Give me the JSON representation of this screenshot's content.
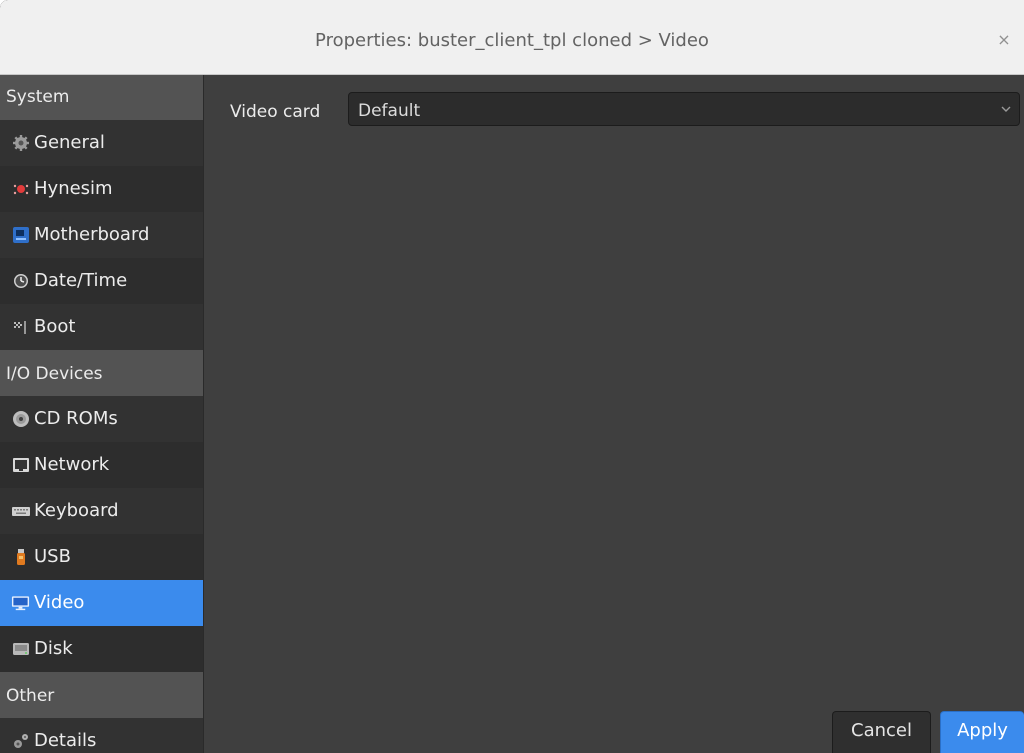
{
  "window": {
    "title": "Properties: buster_client_tpl cloned > Video",
    "close_glyph": "×"
  },
  "sidebar": {
    "sections": [
      {
        "label": "System"
      },
      {
        "label": "I/O Devices"
      },
      {
        "label": "Other"
      }
    ],
    "items": [
      {
        "label": "General",
        "icon": "gear-icon"
      },
      {
        "label": "Hynesim",
        "icon": "hynesim-icon"
      },
      {
        "label": "Motherboard",
        "icon": "motherboard-icon"
      },
      {
        "label": "Date/Time",
        "icon": "clock-icon"
      },
      {
        "label": "Boot",
        "icon": "boot-icon"
      },
      {
        "label": "CD ROMs",
        "icon": "cdrom-icon"
      },
      {
        "label": "Network",
        "icon": "network-icon"
      },
      {
        "label": "Keyboard",
        "icon": "keyboard-icon"
      },
      {
        "label": "USB",
        "icon": "usb-icon"
      },
      {
        "label": "Video",
        "icon": "monitor-icon",
        "selected": true
      },
      {
        "label": "Disk",
        "icon": "disk-icon"
      },
      {
        "label": "Details",
        "icon": "details-icon"
      }
    ]
  },
  "main": {
    "video_card_label": "Video card",
    "video_card_value": "Default"
  },
  "buttons": {
    "cancel": "Cancel",
    "apply": "Apply"
  },
  "colors": {
    "selection": "#3b8bed",
    "sidebar_bg": "#323232",
    "section_header_bg": "#535353",
    "content_bg": "#3f3f3f"
  }
}
